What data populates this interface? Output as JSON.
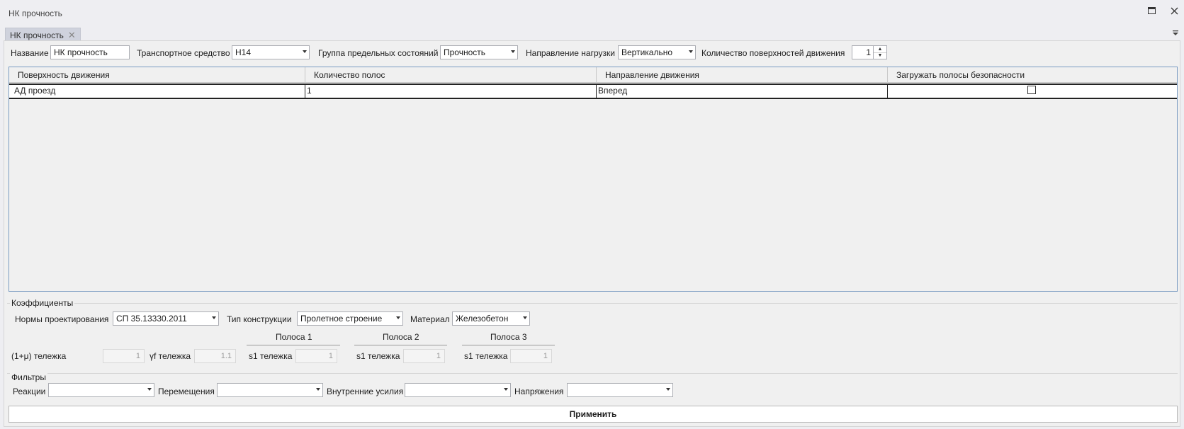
{
  "window": {
    "title": "НК прочность",
    "maximize_icon": "maximize-icon",
    "close_icon": "close-icon"
  },
  "tab": {
    "label": "НК прочность",
    "close_icon": "close-icon",
    "menu_icon": "dropdown-menu-icon"
  },
  "params": {
    "name_label": "Название",
    "name_value": "НК прочность",
    "vehicle_label": "Транспортное средство",
    "vehicle_value": "Н14",
    "group_label": "Группа предельных состояний",
    "group_value": "Прочность",
    "direction_label": "Направление нагрузки",
    "direction_value": "Вертикально",
    "surfaces_label": "Количество поверхностей движения",
    "surfaces_value": "1"
  },
  "grid": {
    "columns": [
      "Поверхность движения",
      "Количество полос",
      "Направление движения",
      "Загружать полосы безопасности"
    ],
    "rows": [
      {
        "surface": "АД проезд",
        "lanes": "1",
        "direction": "Вперед",
        "safety": false
      }
    ]
  },
  "coefficients": {
    "title": "Коэффициенты",
    "norms_label": "Нормы проектирования",
    "norms_value": "СП 35.13330.2011",
    "construction_label": "Тип конструкции",
    "construction_value": "Пролетное строение",
    "material_label": "Материал",
    "material_value": "Железобетон",
    "dyn_label": "(1+μ) тележка",
    "dyn_value": "1",
    "gamma_label": "γf тележка",
    "gamma_value": "1.1",
    "lanes": [
      {
        "title": "Полоса 1",
        "s1_label": "s1 тележка",
        "s1_value": "1"
      },
      {
        "title": "Полоса 2",
        "s1_label": "s1 тележка",
        "s1_value": "1"
      },
      {
        "title": "Полоса 3",
        "s1_label": "s1 тележка",
        "s1_value": "1"
      }
    ]
  },
  "filters": {
    "title": "Фильтры",
    "reactions_label": "Реакции",
    "reactions_value": "",
    "displacements_label": "Перемещения",
    "displacements_value": "",
    "forces_label": "Внутренние усилия",
    "forces_value": "",
    "stresses_label": "Напряжения",
    "stresses_value": ""
  },
  "apply_label": "Применить"
}
